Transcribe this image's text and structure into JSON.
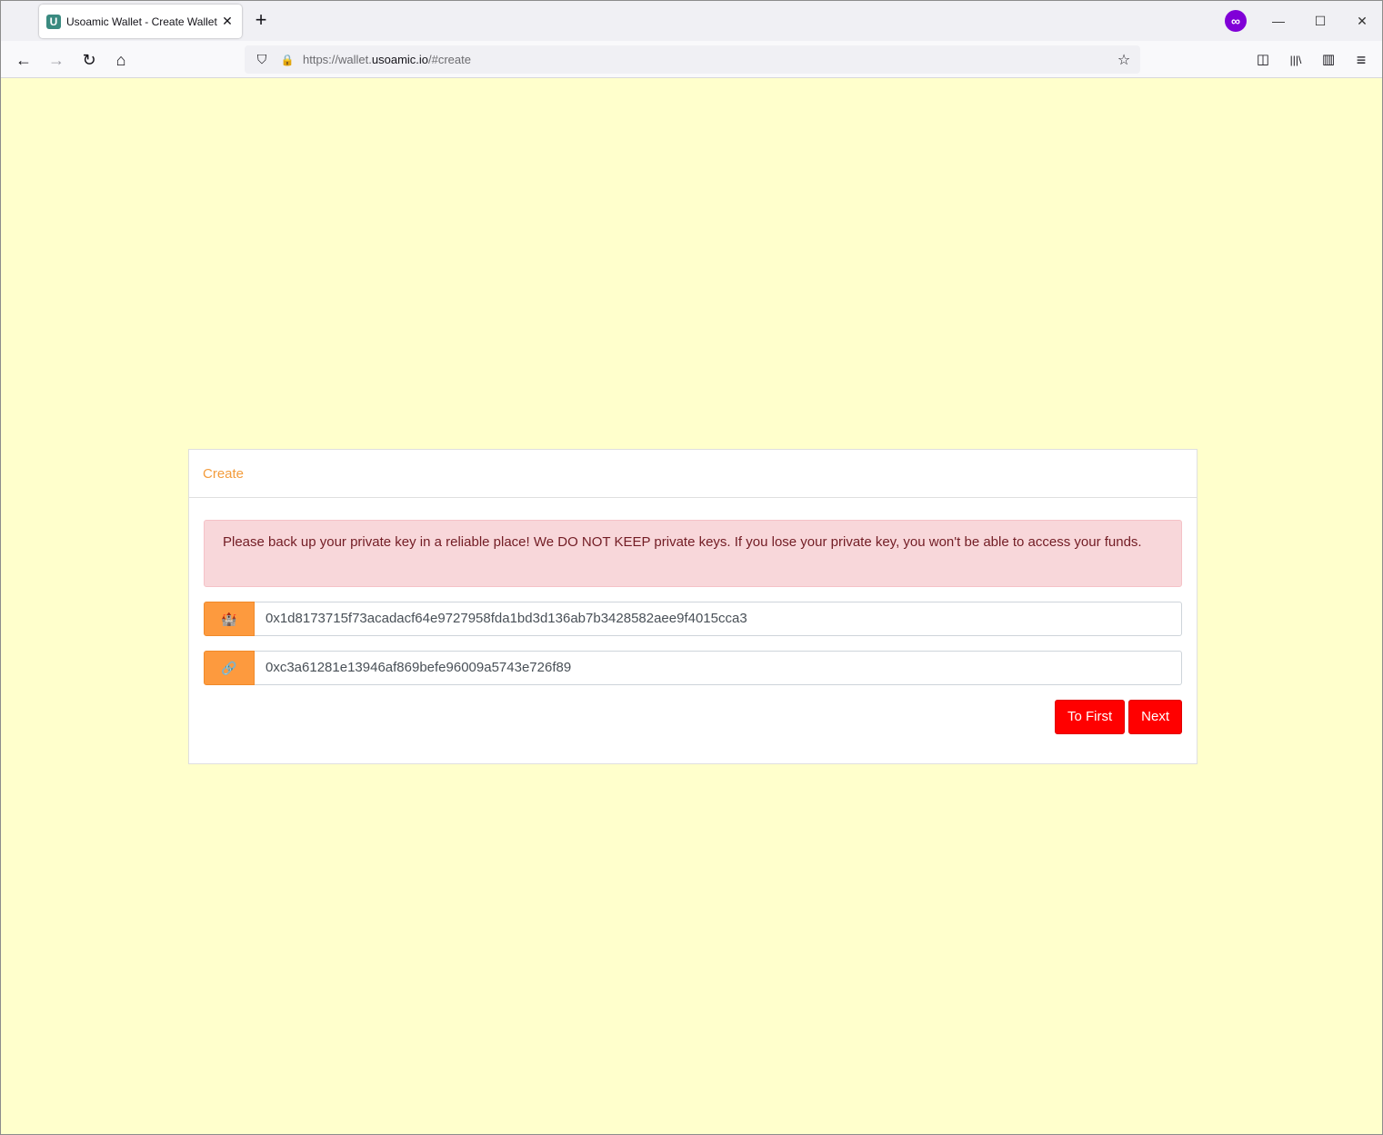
{
  "browser": {
    "tab": {
      "title": "Usoamic Wallet - Create Wallet",
      "favicon_letter": "U",
      "close_glyph": "✕"
    },
    "new_tab_glyph": "+",
    "profile_glyph": "∞",
    "window_controls": {
      "minimize": "—",
      "maximize": "☐",
      "close": "✕"
    },
    "nav": {
      "back": "←",
      "forward": "→",
      "reload": "↻",
      "home": "⌂"
    },
    "url": {
      "prefix": "https://wallet.",
      "domain": "usoamic.io",
      "suffix": "/#create"
    },
    "url_icons": {
      "shield": "⛉",
      "lock": "🔒",
      "star": "☆"
    },
    "toolbar": {
      "pocket": "◫",
      "library": "|||\\",
      "sidebar": "▥",
      "menu": "≡"
    }
  },
  "card": {
    "title": "Create",
    "alert": "Please back up your private key in a reliable place! We DO NOT KEEP private keys. If you lose your private key, you won't be able to access your funds.",
    "private_key": {
      "icon": "🏰",
      "value": "0x1d8173715f73acadacf64e9727958fda1bd3d136ab7b3428582aee9f4015cca3"
    },
    "address": {
      "icon": "🔗",
      "value": "0xc3a61281e13946af869befe96009a5743e726f89"
    },
    "buttons": {
      "to_first": "To First",
      "next": "Next"
    }
  },
  "colors": {
    "page_bg": "#ffffcc",
    "accent_orange": "#fd9a3e",
    "title_orange": "#f39c3c",
    "alert_bg": "#f8d7da",
    "alert_text": "#721c24",
    "button_red": "#ff0000"
  }
}
